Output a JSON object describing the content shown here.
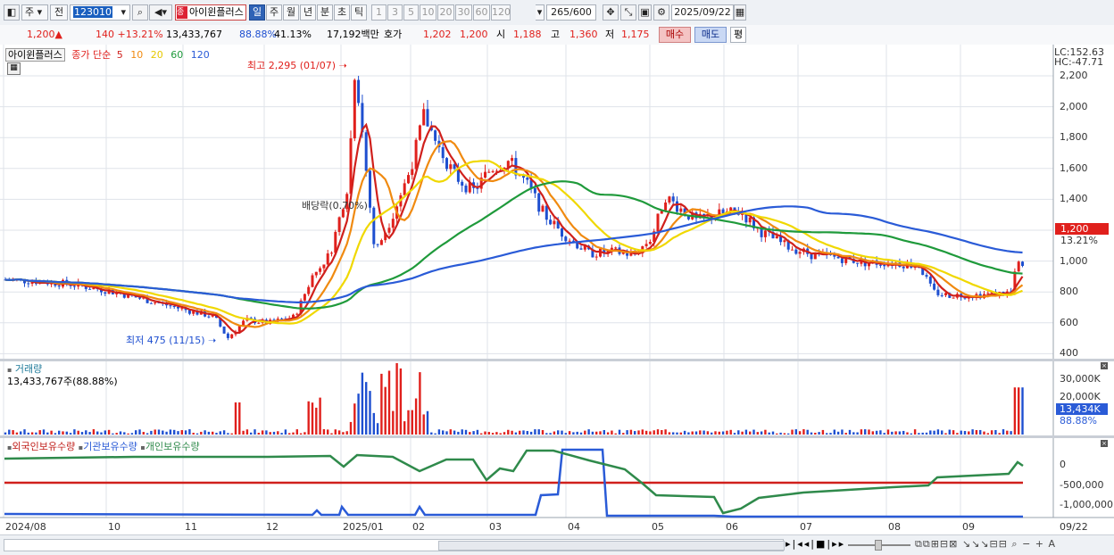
{
  "toolbar": {
    "type_label": "주",
    "prev_label": "전",
    "code": "123010",
    "name_tag": "종",
    "name": "아이윈플러스",
    "periods": [
      "일",
      "주",
      "월",
      "년",
      "분",
      "초",
      "틱"
    ],
    "active_period": "일",
    "numbers": [
      "1",
      "3",
      "5",
      "10",
      "20",
      "30",
      "60",
      "120"
    ],
    "count_value": "265",
    "count_total": "/600",
    "date": "2025/09/22"
  },
  "quote": {
    "price": "1,200▲",
    "change": "140 +13.21%",
    "volume": "13,433,767",
    "volume_ratio": "88.88%",
    "turnover": "41.13%",
    "amount": "17,192백만",
    "ask_label": "호가",
    "ask_sell": "1,202",
    "ask_buy": "1,200",
    "open_label": "시",
    "open": "1,188",
    "high_label": "고",
    "high": "1,360",
    "low_label": "저",
    "low": "1,175",
    "buy_button": "매수",
    "sell_button": "매도",
    "eval_button": "평"
  },
  "price_panel": {
    "title": "아이윈플러스",
    "legend_prefix": "종가 단순",
    "ma_periods": [
      "5",
      "10",
      "20",
      "60",
      "120"
    ],
    "ma_colors": [
      "#d0201c",
      "#f08a10",
      "#f0d800",
      "#1f9a3b",
      "#2a5bd7"
    ],
    "lc": "LC:152.63",
    "hc": "HC:-47.71",
    "high_note": "최고 2,295 (01/07)",
    "low_note": "최저 475 (11/15)",
    "dividend_note": "배당락(0.70%)",
    "current_price": "1,200",
    "current_change": "13.21%",
    "y_ticks": [
      "2,200",
      "2,000",
      "1,800",
      "1,600",
      "1,400",
      "1,200",
      "1,000",
      "800",
      "600",
      "400"
    ]
  },
  "volume_panel": {
    "title": "거래량",
    "value": "13,433,767주(88.88%)",
    "y_ticks": [
      "30,000K",
      "20,000K"
    ],
    "current": "13,434K",
    "current_ratio": "88.88%"
  },
  "holding_panel": {
    "legend": [
      "외국인보유수량",
      "기관보유수량",
      "개인보유수량"
    ],
    "legend_colors": [
      "#c0201c",
      "#2a5bd7",
      "#2f8a4b"
    ],
    "y_ticks": [
      "0",
      "-500,000",
      "-1,000,000"
    ]
  },
  "x_axis": {
    "labels": [
      "2024/08",
      "10",
      "11",
      "12",
      "2025/01",
      "02",
      "03",
      "04",
      "05",
      "06",
      "07",
      "08",
      "09",
      "09/22"
    ]
  },
  "chart_data": {
    "type": "candlestick",
    "period": "daily",
    "ylim": [
      400,
      2300
    ],
    "high": {
      "value": 2295,
      "date": "01/07"
    },
    "low": {
      "value": 475,
      "date": "11/15"
    },
    "last": {
      "open": 1188,
      "high": 1360,
      "low": 1175,
      "close": 1200
    }
  }
}
